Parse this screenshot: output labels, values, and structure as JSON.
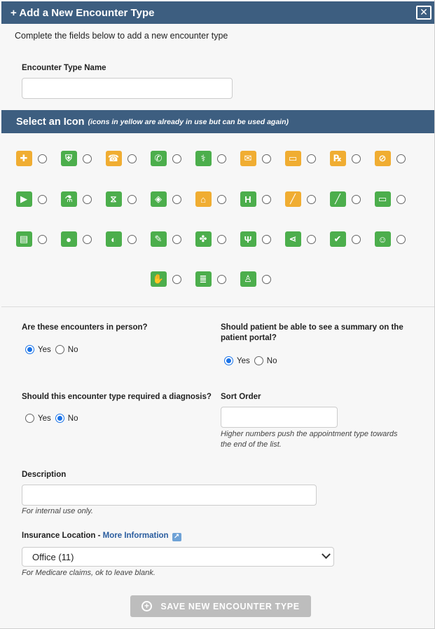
{
  "modal": {
    "title": "+ Add a New Encounter Type",
    "close_label": "✕",
    "intro": "Complete the fields below to add a new encounter type"
  },
  "name_field": {
    "label": "Encounter Type Name",
    "value": "",
    "placeholder": ""
  },
  "icon_section": {
    "title": "Select an Icon",
    "note": "(icons in yellow are already in use but can be used again)",
    "rows": [
      [
        {
          "name": "first-aid-cross-icon",
          "glyph": "✚",
          "color": "yellow"
        },
        {
          "name": "medical-bag-icon",
          "glyph": "⛨",
          "color": "green"
        },
        {
          "name": "telephone-icon",
          "glyph": "☎",
          "color": "yellow"
        },
        {
          "name": "phone-handset-icon",
          "glyph": "✆",
          "color": "green"
        },
        {
          "name": "stethoscope-icon",
          "glyph": "⚕",
          "color": "green"
        },
        {
          "name": "envelope-icon",
          "glyph": "✉",
          "color": "yellow"
        },
        {
          "name": "chat-bubble-icon",
          "glyph": "▭",
          "color": "yellow"
        },
        {
          "name": "prescription-icon",
          "glyph": "℞",
          "color": "yellow"
        },
        {
          "name": "bandage-icon",
          "glyph": "⊘",
          "color": "yellow"
        }
      ],
      [
        {
          "name": "video-camera-icon",
          "glyph": "▶",
          "color": "green"
        },
        {
          "name": "lab-flask-icon",
          "glyph": "⚗",
          "color": "green"
        },
        {
          "name": "dna-icon",
          "glyph": "⧖",
          "color": "green"
        },
        {
          "name": "cube-icon",
          "glyph": "◈",
          "color": "green"
        },
        {
          "name": "home-icon",
          "glyph": "⌂",
          "color": "yellow"
        },
        {
          "name": "hospital-h-icon",
          "glyph": "H",
          "color": "green"
        },
        {
          "name": "scalpel-icon",
          "glyph": "╱",
          "color": "yellow"
        },
        {
          "name": "needle-icon",
          "glyph": "╱",
          "color": "green"
        },
        {
          "name": "message-bubble-icon",
          "glyph": "▭",
          "color": "green"
        }
      ],
      [
        {
          "name": "medical-device-icon",
          "glyph": "▤",
          "color": "green"
        },
        {
          "name": "apple-icon",
          "glyph": "●",
          "color": "green"
        },
        {
          "name": "apple-bite-icon",
          "glyph": "◐",
          "color": "green"
        },
        {
          "name": "syringe-icon",
          "glyph": "✎",
          "color": "green"
        },
        {
          "name": "running-person-icon",
          "glyph": "✤",
          "color": "green"
        },
        {
          "name": "fork-knife-icon",
          "glyph": "Ψ",
          "color": "green"
        },
        {
          "name": "share-icon",
          "glyph": "⋖",
          "color": "green"
        },
        {
          "name": "check-badge-icon",
          "glyph": "✔",
          "color": "green"
        },
        {
          "name": "conversation-icon",
          "glyph": "☺",
          "color": "green"
        }
      ],
      [
        {
          "name": "helping-hand-icon",
          "glyph": "✋",
          "color": "green"
        },
        {
          "name": "spine-icon",
          "glyph": "≣",
          "color": "green"
        },
        {
          "name": "mother-child-icon",
          "glyph": "♙",
          "color": "green"
        }
      ]
    ]
  },
  "in_person": {
    "question": "Are these encounters in person?",
    "options": [
      {
        "label": "Yes",
        "checked": true
      },
      {
        "label": "No",
        "checked": false
      }
    ]
  },
  "portal_summary": {
    "question_line1": "Should patient be able to see a summary on the",
    "question_line2": "patient portal?",
    "options": [
      {
        "label": "Yes",
        "checked": true
      },
      {
        "label": "No",
        "checked": false
      }
    ]
  },
  "diagnosis": {
    "question": "Should this encounter type required a diagnosis?",
    "options": [
      {
        "label": "Yes",
        "checked": false
      },
      {
        "label": "No",
        "checked": true
      }
    ]
  },
  "sort_order": {
    "label": "Sort Order",
    "value": "",
    "hint_line1": "Higher numbers push the appointment type towards",
    "hint_line2": "the end of the list."
  },
  "description": {
    "label": "Description",
    "value": "",
    "hint": "For internal use only."
  },
  "insurance_location": {
    "label": "Insurance Location - ",
    "link_text": "More Information",
    "selected": "Office (11)",
    "hint": "For Medicare claims, ok to leave blank."
  },
  "save_button": {
    "label": "SAVE NEW ENCOUNTER TYPE"
  },
  "colors": {
    "header": "#3d5e80",
    "icon_green": "#4cae4c",
    "icon_yellow": "#f0ad32",
    "button_disabled": "#bdbdbd",
    "radio_checked": "#1a73e8",
    "link": "#2a5d9f"
  }
}
